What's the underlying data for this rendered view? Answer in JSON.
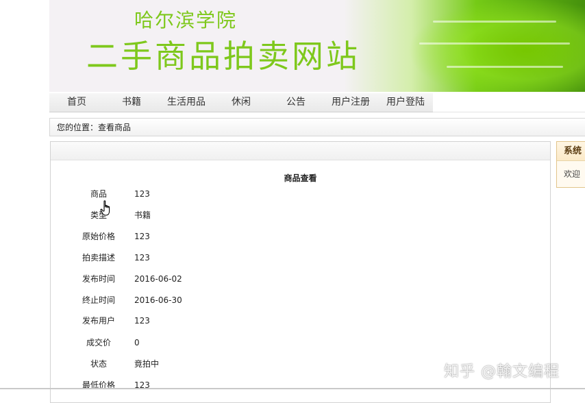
{
  "banner": {
    "school": "哈尔滨学院",
    "site_name": "二手商品拍卖网站"
  },
  "nav": {
    "items": [
      {
        "label": "首页"
      },
      {
        "label": "书籍"
      },
      {
        "label": "生活用品"
      },
      {
        "label": "休闲"
      },
      {
        "label": "公告"
      },
      {
        "label": "用户注册"
      },
      {
        "label": "用户登陆"
      }
    ]
  },
  "breadcrumb": "您的位置：查看商品",
  "detail": {
    "title": "商品查看",
    "fields": [
      {
        "label": "商品",
        "value": "123"
      },
      {
        "label": "类型",
        "value": "书籍"
      },
      {
        "label": "原始价格",
        "value": "123"
      },
      {
        "label": "拍卖描述",
        "value": "123"
      },
      {
        "label": "发布时间",
        "value": "2016-06-02"
      },
      {
        "label": "终止时间",
        "value": "2016-06-30"
      },
      {
        "label": "发布用户",
        "value": "123"
      },
      {
        "label": "成交价",
        "value": "0"
      },
      {
        "label": "状态",
        "value": "竟拍中"
      },
      {
        "label": "最低价格",
        "value": "123"
      }
    ]
  },
  "side": {
    "title": "系统",
    "body": "欢迎"
  },
  "watermark": "知乎 @翰文编程",
  "colors": {
    "brand_green": "#7ec81c",
    "side_border": "#e2c48a"
  }
}
